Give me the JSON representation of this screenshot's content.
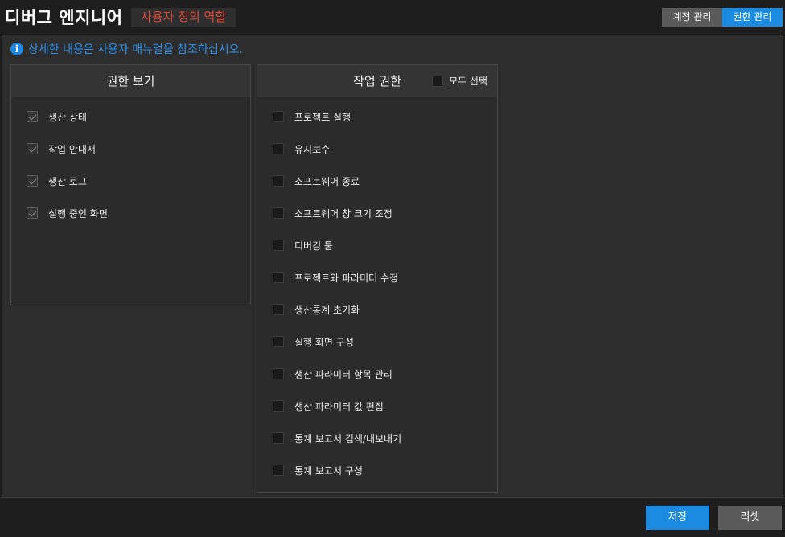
{
  "header": {
    "title": "디버그 엔지니어",
    "role_tag": "사용자 정의 역할",
    "tabs": {
      "account": "계정 관리",
      "permission": "권한 관리"
    }
  },
  "info": {
    "icon": "info-icon",
    "glyph": "i",
    "text": "상세한 내용은 사용자 매뉴얼을 참조하십시오."
  },
  "view_panel": {
    "title": "권한 보기",
    "items": [
      {
        "label": "생산 상태",
        "checked": true
      },
      {
        "label": "작업 안내서",
        "checked": true
      },
      {
        "label": "생산 로그",
        "checked": true
      },
      {
        "label": "실행 중인 화면",
        "checked": true
      }
    ]
  },
  "work_panel": {
    "title": "작업 권한",
    "select_all": "모두 선택",
    "items": [
      {
        "label": "프로젝트 실행",
        "checked": false
      },
      {
        "label": "유지보수",
        "checked": false
      },
      {
        "label": "소프트웨어 종료",
        "checked": false
      },
      {
        "label": "소프트웨어 창 크기 조정",
        "checked": false
      },
      {
        "label": "디버깅 툴",
        "checked": false
      },
      {
        "label": "프로젝트와 파라미터 수정",
        "checked": false
      },
      {
        "label": "생산통계 초기화",
        "checked": false
      },
      {
        "label": "실행 화면 구성",
        "checked": false
      },
      {
        "label": "생산 파라미터 항목 관리",
        "checked": false
      },
      {
        "label": "생산 파라미터 값 편집",
        "checked": false
      },
      {
        "label": "통계 보고서 검색/내보내기",
        "checked": false
      },
      {
        "label": "통계 보고서 구성",
        "checked": false
      }
    ]
  },
  "footer": {
    "save": "저장",
    "reset": "리셋"
  },
  "colors": {
    "accent": "#1a8be0",
    "role_tag_text": "#e04b3a",
    "info_text": "#2f8fe8"
  }
}
